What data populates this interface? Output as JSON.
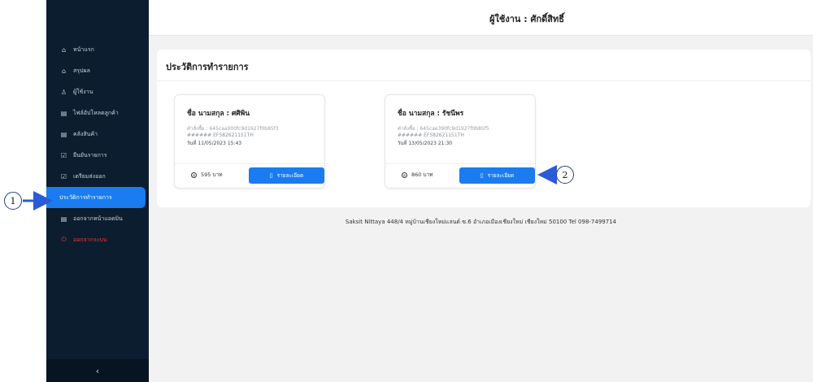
{
  "header": {
    "title": "ผู้ใช้งาน : ศักดิ์สิทธิ์"
  },
  "sidebar": {
    "items": [
      {
        "label": "หน้าแรก",
        "icon": "home-icon",
        "glyph": "⌂"
      },
      {
        "label": "สรุปผล",
        "icon": "home-icon",
        "glyph": "⌂"
      },
      {
        "label": "ผู้ใช้งาน",
        "icon": "user-icon",
        "glyph": "♙"
      },
      {
        "label": "ไฟล์อัปโหลดลูกค้า",
        "icon": "file-icon",
        "glyph": "▤"
      },
      {
        "label": "คลังสินค้า",
        "icon": "warehouse-icon",
        "glyph": "▤"
      },
      {
        "label": "ยืนยันรายการ",
        "icon": "clipboard-check-icon",
        "glyph": "☑"
      },
      {
        "label": "เตรียมส่งออก",
        "icon": "clipboard-icon",
        "glyph": "☑"
      },
      {
        "label": "ประวัติการทำรายการ",
        "icon": "history-icon",
        "glyph": "",
        "active": true
      },
      {
        "label": "ออกจากหน้าแอดมิน",
        "icon": "exit-admin-icon",
        "glyph": "▤"
      },
      {
        "label": "ออกจากระบบ",
        "icon": "power-icon",
        "glyph": "⏻",
        "danger": true
      }
    ],
    "collapse_label": "‹"
  },
  "main": {
    "panel_title": "ประวัติการทำรายการ",
    "orders": [
      {
        "name": "ชื่อ นามสกุล : ศศิพิน",
        "order_line": "คำสั่งซื้อ : 645caa000fc9d1927f0b85f3",
        "tracking_line": "######  EF582621151TH",
        "date_line": "วันที่ 11/05/2023 15:43",
        "price": "595 บาท",
        "button_label": "รายละเอียด"
      },
      {
        "name": "ชื่อ นามสกุล : รัชนีพร",
        "order_line": "คำสั่งซื้อ : 645cae390fc9d1927f0b85f5",
        "tracking_line": "######  EF582621151TH",
        "date_line": "วันที่ 13/05/2023 21:30",
        "price": "860 บาท",
        "button_label": "รายละเอียด"
      }
    ]
  },
  "footer": {
    "text": "Saksit Nittaya 448/4 หมู่บ้านเชียงใหม่แลนด์ ซ.6 อำเภอเมืองเชียงใหม่ เชียงใหม่ 50100 Tel 098-7499714"
  },
  "annotations": {
    "callout_1": "1",
    "callout_2": "2"
  },
  "colors": {
    "sidebar_bg": "#0b1d2e",
    "accent": "#1a7cf0",
    "danger": "#ef3b3b",
    "main_bg": "#f2f2f2"
  }
}
